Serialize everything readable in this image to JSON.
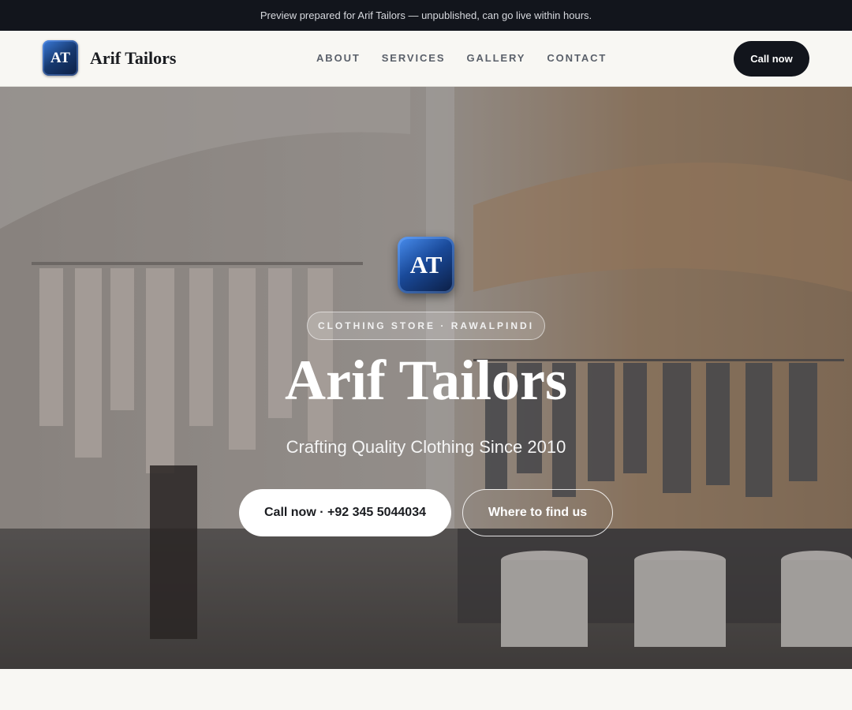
{
  "preview_banner": "Preview prepared for Arif Tailors — unpublished, can go live within hours.",
  "nav": {
    "logo_text": "AT",
    "brand_name": "Arif Tailors",
    "links": [
      {
        "label": "ABOUT"
      },
      {
        "label": "SERVICES"
      },
      {
        "label": "GALLERY"
      },
      {
        "label": "CONTACT"
      }
    ],
    "cta_label": "Call now"
  },
  "hero": {
    "logo_text": "AT",
    "eyebrow": "CLOTHING STORE · RAWALPINDI",
    "title": "Arif Tailors",
    "subtitle": "Crafting Quality Clothing Since 2010",
    "primary_button": "Call now · +92 345 5044034",
    "secondary_button": "Where to find us"
  },
  "colors": {
    "dark": "#12151c",
    "page_bg": "#f8f7f3",
    "logo_blue": "#1a4a9a"
  }
}
